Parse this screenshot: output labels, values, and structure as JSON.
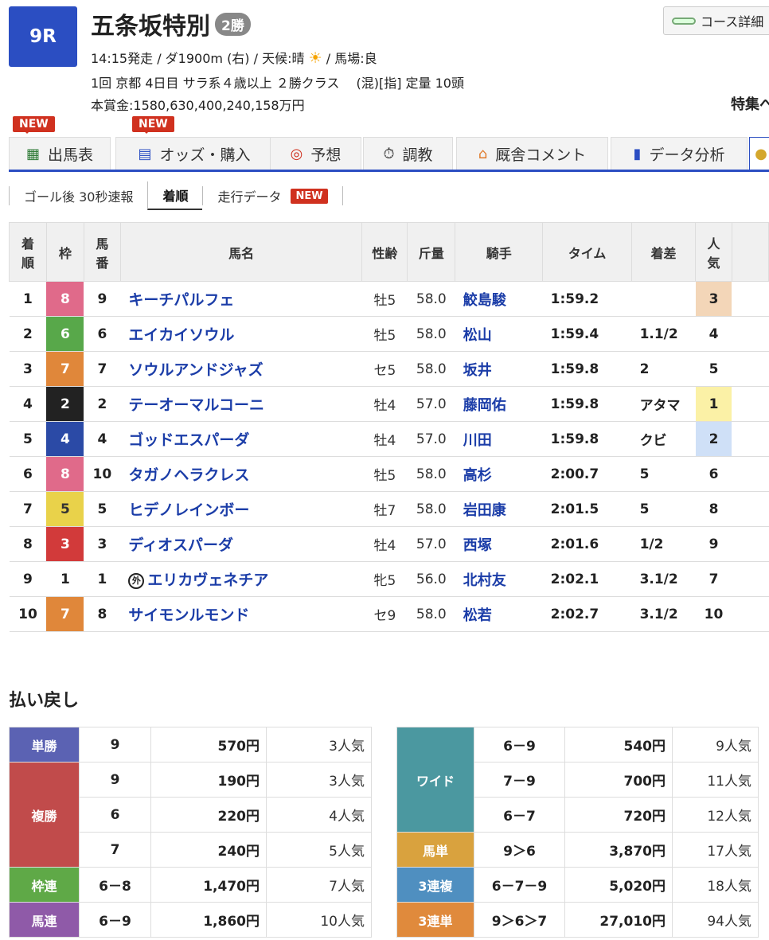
{
  "race": {
    "number": "9R",
    "title": "五条坂特別",
    "grade": "2勝",
    "line1_pre": "14:15発走 / ダ1900m (右) / 天候:晴",
    "weather_icon": "sun-icon",
    "line1_post": "/ 馬場:良",
    "line2": "1回 京都 4日目 サラ系４歳以上 ２勝クラス　 (混)[指] 定量 10頭",
    "line3": "本賞金:1580,630,400,240,158万円",
    "course_button": "コース詳細",
    "tokushu": "特集へ"
  },
  "tabs": [
    {
      "label": "出馬表",
      "icon": "table-icon",
      "new": "NEW"
    },
    {
      "label": "オッズ・購入",
      "icon": "ipat-icon",
      "new": "NEW"
    },
    {
      "label": "予想",
      "icon": "target-icon"
    },
    {
      "label": "調教",
      "icon": "stopwatch-icon"
    },
    {
      "label": "厩舎コメント",
      "icon": "stable-icon"
    },
    {
      "label": "データ分析",
      "icon": "bar-chart-icon"
    }
  ],
  "subtabs": [
    {
      "label": "ゴール後 30秒速報"
    },
    {
      "label": "着順"
    },
    {
      "label": "走行データ",
      "new": "NEW"
    }
  ],
  "result": {
    "headers": {
      "rank": "着順",
      "waku": "枠",
      "num": "馬番",
      "horse": "馬名",
      "sexage": "性齢",
      "weight": "斤量",
      "jockey": "騎手",
      "time": "タイム",
      "margin": "着差",
      "pop": "人気"
    },
    "rows": [
      {
        "rank": "1",
        "waku": "8",
        "num": "9",
        "horse": "キーチパルフェ",
        "sexage": "牡5",
        "weight": "58.0",
        "jockey": "鮫島駿",
        "time": "1:59.2",
        "margin": "",
        "pop": "3"
      },
      {
        "rank": "2",
        "waku": "6",
        "num": "6",
        "horse": "エイカイソウル",
        "sexage": "牡5",
        "weight": "58.0",
        "jockey": "松山",
        "time": "1:59.4",
        "margin": "1.1/2",
        "pop": "4"
      },
      {
        "rank": "3",
        "waku": "7",
        "num": "7",
        "horse": "ソウルアンドジャズ",
        "sexage": "セ5",
        "weight": "58.0",
        "jockey": "坂井",
        "time": "1:59.8",
        "margin": "2",
        "pop": "5"
      },
      {
        "rank": "4",
        "waku": "2",
        "num": "2",
        "horse": "テーオーマルコーニ",
        "sexage": "牡4",
        "weight": "57.0",
        "jockey": "藤岡佑",
        "time": "1:59.8",
        "margin": "アタマ",
        "pop": "1"
      },
      {
        "rank": "5",
        "waku": "4",
        "num": "4",
        "horse": "ゴッドエスパーダ",
        "sexage": "牡4",
        "weight": "57.0",
        "jockey": "川田",
        "time": "1:59.8",
        "margin": "クビ",
        "pop": "2"
      },
      {
        "rank": "6",
        "waku": "8",
        "num": "10",
        "horse": "タガノヘラクレス",
        "sexage": "牡5",
        "weight": "58.0",
        "jockey": "高杉",
        "time": "2:00.7",
        "margin": "5",
        "pop": "6"
      },
      {
        "rank": "7",
        "waku": "5",
        "num": "5",
        "horse": "ヒデノレインボー",
        "sexage": "牡7",
        "weight": "58.0",
        "jockey": "岩田康",
        "time": "2:01.5",
        "margin": "5",
        "pop": "8"
      },
      {
        "rank": "8",
        "waku": "3",
        "num": "3",
        "horse": "ディオスパーダ",
        "sexage": "牡4",
        "weight": "57.0",
        "jockey": "西塚",
        "time": "2:01.6",
        "margin": "1/2",
        "pop": "9"
      },
      {
        "rank": "9",
        "waku": "1",
        "num": "1",
        "horse": "エリカヴェネチア",
        "gai": "外",
        "sexage": "牝5",
        "weight": "56.0",
        "jockey": "北村友",
        "time": "2:02.1",
        "margin": "3.1/2",
        "pop": "7"
      },
      {
        "rank": "10",
        "waku": "7",
        "num": "8",
        "horse": "サイモンルモンド",
        "sexage": "セ9",
        "weight": "58.0",
        "jockey": "松若",
        "time": "2:02.7",
        "margin": "3.1/2",
        "pop": "10"
      }
    ]
  },
  "payout": {
    "title": "払い戻し",
    "left": [
      {
        "label": "単勝",
        "color": "#5b62b3",
        "entries": [
          {
            "comb": "9",
            "amount": "570円",
            "pop": "3人気"
          }
        ]
      },
      {
        "label": "複勝",
        "color": "#c14b4b",
        "entries": [
          {
            "comb": "9",
            "amount": "190円",
            "pop": "3人気"
          },
          {
            "comb": "6",
            "amount": "220円",
            "pop": "4人気"
          },
          {
            "comb": "7",
            "amount": "240円",
            "pop": "5人気"
          }
        ]
      },
      {
        "label": "枠連",
        "color": "#5fa947",
        "entries": [
          {
            "comb": "6－8",
            "amount": "1,470円",
            "pop": "7人気"
          }
        ]
      },
      {
        "label": "馬連",
        "color": "#8f5aa8",
        "entries": [
          {
            "comb": "6－9",
            "amount": "1,860円",
            "pop": "10人気"
          }
        ]
      }
    ],
    "right": [
      {
        "label": "ワイド",
        "color": "#4b98a0",
        "entries": [
          {
            "comb": "6－9",
            "amount": "540円",
            "pop": "9人気"
          },
          {
            "comb": "7－9",
            "amount": "700円",
            "pop": "11人気"
          },
          {
            "comb": "6－7",
            "amount": "720円",
            "pop": "12人気"
          }
        ]
      },
      {
        "label": "馬単",
        "color": "#d9a23e",
        "entries": [
          {
            "comb": "9＞6",
            "amount": "3,870円",
            "pop": "17人気"
          }
        ]
      },
      {
        "label": "3連複",
        "color": "#4f8fc0",
        "entries": [
          {
            "comb": "6－7－9",
            "amount": "5,020円",
            "pop": "18人気"
          }
        ]
      },
      {
        "label": "3連単",
        "color": "#e08a3c",
        "entries": [
          {
            "comb": "9＞6＞7",
            "amount": "27,010円",
            "pop": "94人気"
          }
        ]
      }
    ]
  },
  "colors": {
    "waku": {
      "1": "#ffffff",
      "2": "#222222",
      "3": "#d23a3a",
      "4": "#2b4aa6",
      "5": "#e9d24a",
      "6": "#58a84a",
      "7": "#e0873a",
      "8": "#e06a8a"
    },
    "waku_text": {
      "1": "#222222",
      "5": "#333333"
    },
    "pop_highlight": {
      "1": "#fbf1a6",
      "2": "#cfe0f7",
      "3": "#f3d6b8"
    }
  }
}
